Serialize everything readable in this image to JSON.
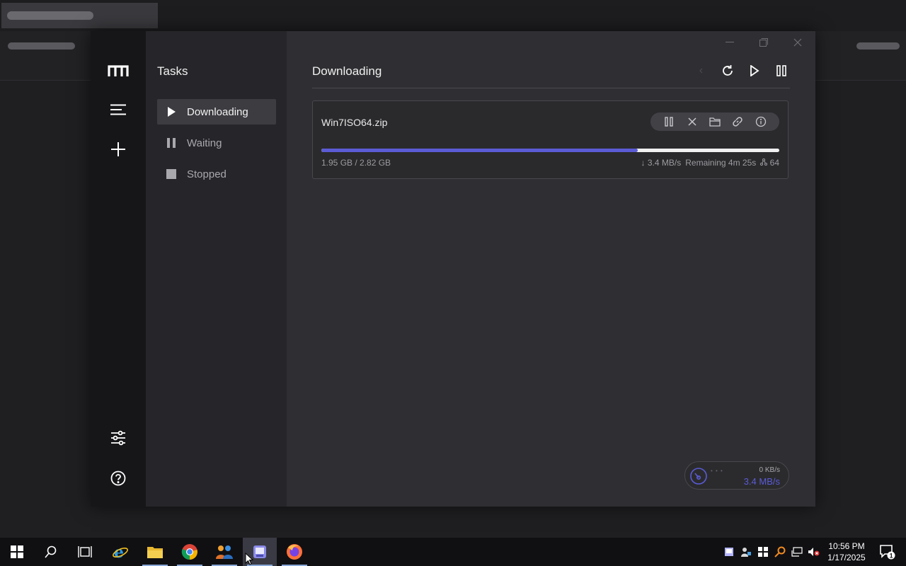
{
  "app": {
    "tasks_title": "Tasks",
    "main_heading": "Downloading",
    "accent_color": "#5b5bd6"
  },
  "task_nav": [
    {
      "label": "Downloading",
      "icon": "play-icon",
      "active": true
    },
    {
      "label": "Waiting",
      "icon": "pause-icon",
      "active": false
    },
    {
      "label": "Stopped",
      "icon": "stop-icon",
      "active": false
    }
  ],
  "download": {
    "filename": "Win7ISO64.zip",
    "progress_fraction": 0.691,
    "sizes": "1.95 GB / 2.82 GB",
    "speed": "↓ 3.4 MB/s",
    "remaining": "Remaining 4m 25s",
    "connections": "64"
  },
  "speed_widget": {
    "upload": "0 KB/s",
    "download": "3.4 MB/s"
  },
  "taskbar": {
    "time": "10:56 PM",
    "date": "1/17/2025",
    "notification_count": "1"
  }
}
